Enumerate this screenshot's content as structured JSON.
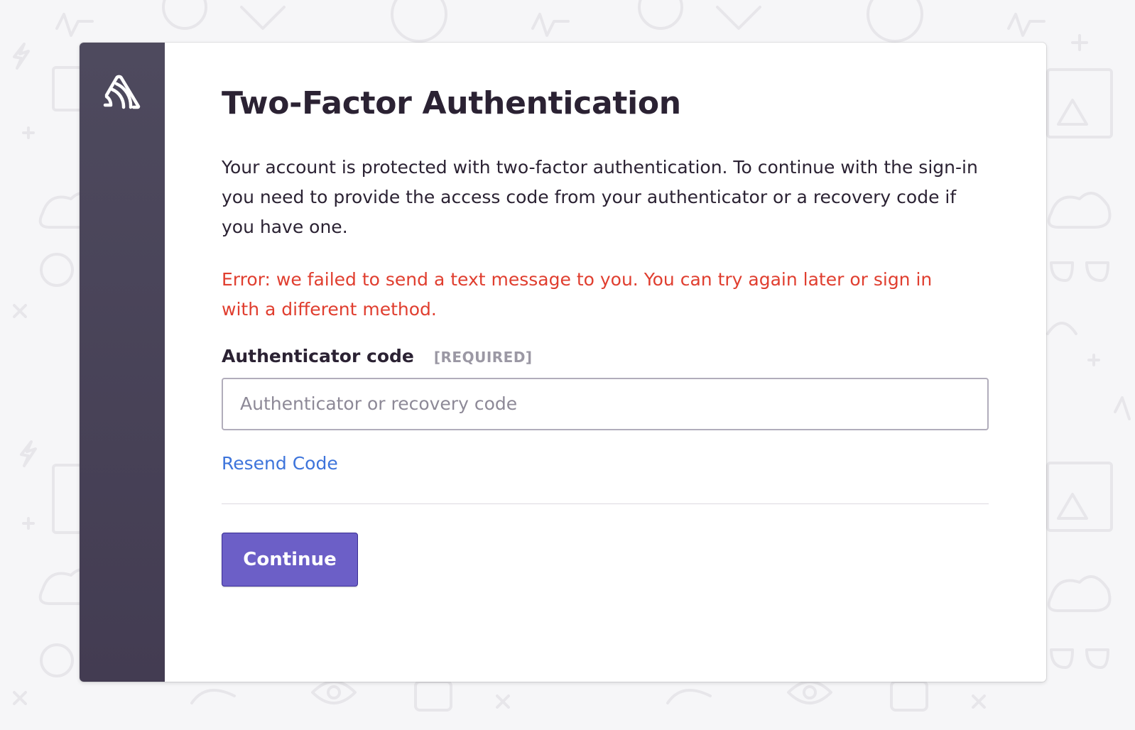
{
  "brand": {
    "logo_icon": "sentry-logo-icon",
    "sidebar_color": "#4a4458"
  },
  "page": {
    "title": "Two-Factor Authentication",
    "description": "Your account is protected with two-factor authentication. To continue with the sign-in you need to provide the access code from your authenticator or a recovery code if you have one.",
    "error_message": "Error: we failed to send a text message to you. You can try again later or sign in with a different method."
  },
  "form": {
    "field_label": "Authenticator code",
    "required_tag": "[REQUIRED]",
    "input_value": "",
    "input_placeholder": "Authenticator or recovery code",
    "resend_label": "Resend Code",
    "submit_label": "Continue"
  },
  "colors": {
    "accent": "#6c5fc7",
    "error": "#e03e2f",
    "link": "#3d74db"
  }
}
